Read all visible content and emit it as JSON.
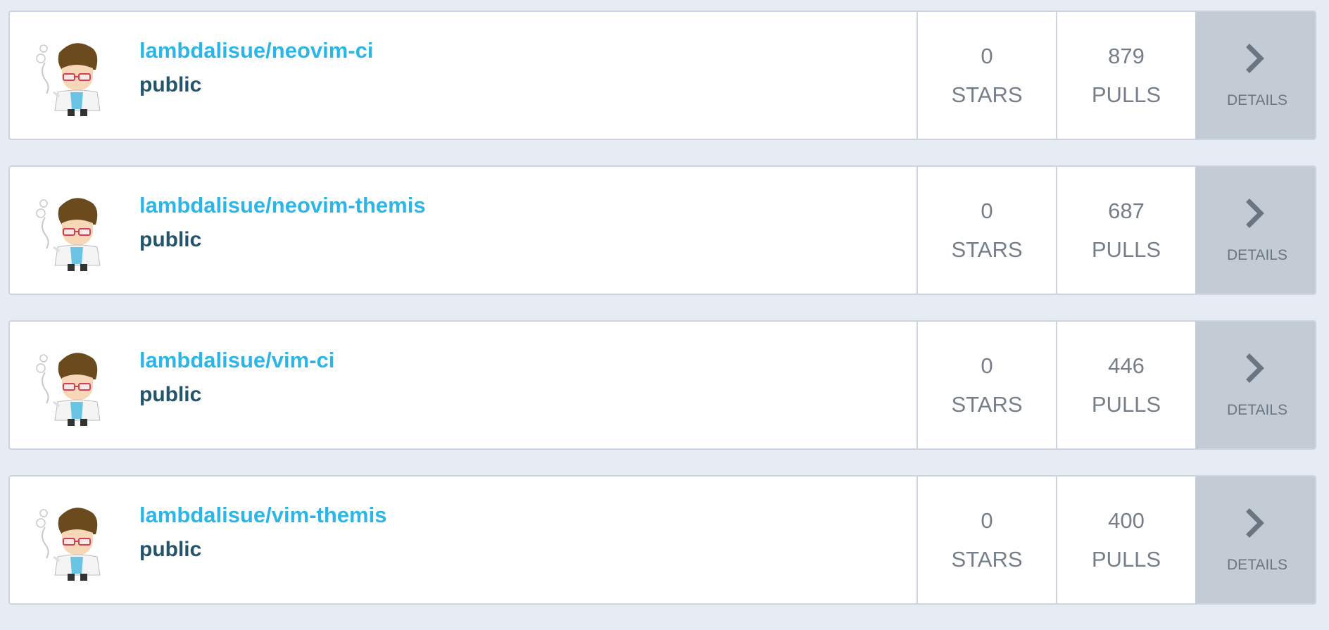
{
  "repositories": [
    {
      "name": "lambdalisue/neovim-ci",
      "visibility": "public",
      "stars": "0",
      "stars_label": "STARS",
      "pulls": "879",
      "pulls_label": "PULLS",
      "details_label": "DETAILS",
      "avatar_icon": "user-avatar-icon",
      "details_icon": "chevron-right-icon"
    },
    {
      "name": "lambdalisue/neovim-themis",
      "visibility": "public",
      "stars": "0",
      "stars_label": "STARS",
      "pulls": "687",
      "pulls_label": "PULLS",
      "details_label": "DETAILS",
      "avatar_icon": "user-avatar-icon",
      "details_icon": "chevron-right-icon"
    },
    {
      "name": "lambdalisue/vim-ci",
      "visibility": "public",
      "stars": "0",
      "stars_label": "STARS",
      "pulls": "446",
      "pulls_label": "PULLS",
      "details_label": "DETAILS",
      "avatar_icon": "user-avatar-icon",
      "details_icon": "chevron-right-icon"
    },
    {
      "name": "lambdalisue/vim-themis",
      "visibility": "public",
      "stars": "0",
      "stars_label": "STARS",
      "pulls": "400",
      "pulls_label": "PULLS",
      "details_label": "DETAILS",
      "avatar_icon": "user-avatar-icon",
      "details_icon": "chevron-right-icon"
    }
  ],
  "colors": {
    "page_background": "#e7ecf4",
    "card_border": "#ccd4df",
    "repo_link": "#2eb5e8",
    "visibility_text": "#23546d",
    "stat_text": "#757f8a",
    "details_background": "#c3cbd5"
  }
}
